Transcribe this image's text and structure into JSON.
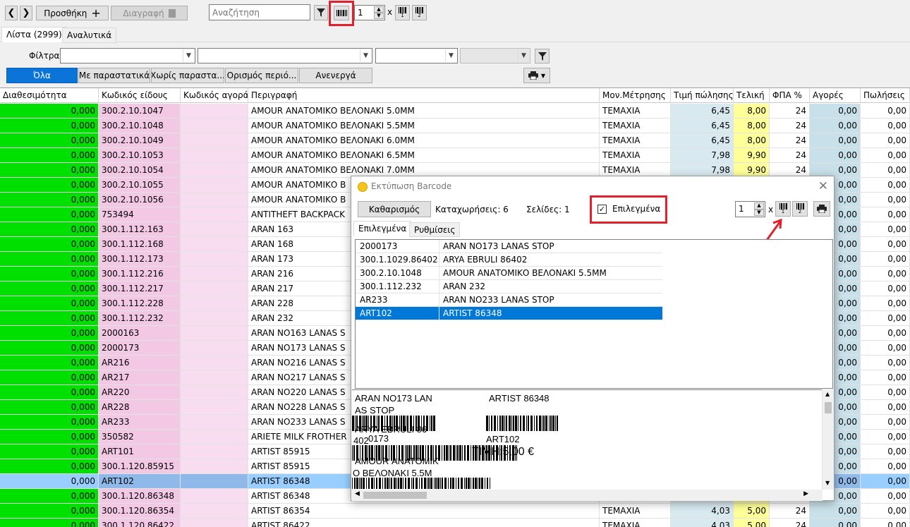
{
  "toolbar": {
    "add_label": "Προσθήκη",
    "delete_label": "Διαγραφή",
    "search_placeholder": "Αναζήτηση",
    "copies_value": "1",
    "times_label": "x",
    "label1": "1",
    "label2": "2"
  },
  "tabs": [
    "Λίστα (2999)",
    "Αναλυτικά"
  ],
  "filters": {
    "label": "Φίλτρα",
    "buttons": [
      "Όλα",
      "Με παραστατικά",
      "Χωρίς παραστα...",
      "Ορισμός περιό...",
      "Ανενεργά"
    ]
  },
  "grid": {
    "headers": [
      "Διαθεσιμότητα",
      "Κωδικός είδους",
      "Κωδικός αγοράς",
      "Περιγραφή",
      "Μον.Μέτρησης",
      "Τιμή πώλησης",
      "Τελική",
      "ΦΠΑ %",
      "Αγορές",
      "Πωλήσεις"
    ],
    "rows": [
      [
        "0,000",
        "300.2.10.1047",
        "",
        "AMOUR ΑΝΑΤΟΜΙΚΟ ΒΕΛΟΝΑΚΙ 5.0MM",
        "ΤΕΜΑΧΙΑ",
        "6,45",
        "8,00",
        "24",
        "0,00",
        "0,00"
      ],
      [
        "0,000",
        "300.2.10.1048",
        "",
        "AMOUR ΑΝΑΤΟΜΙΚΟ ΒΕΛΟΝΑΚΙ 5.5MM",
        "ΤΕΜΑΧΙΑ",
        "6,45",
        "8,00",
        "24",
        "0,00",
        "0,00"
      ],
      [
        "0,000",
        "300.2.10.1049",
        "",
        "AMOUR ΑΝΑΤΟΜΙΚΟ ΒΕΛΟΝΑΚΙ 6.0MM",
        "ΤΕΜΑΧΙΑ",
        "6,45",
        "8,00",
        "24",
        "0,00",
        "0,00"
      ],
      [
        "0,000",
        "300.2.10.1053",
        "",
        "AMOUR ΑΝΑΤΟΜΙΚΟ ΒΕΛΟΝΑΚΙ 6.5MM",
        "ΤΕΜΑΧΙΑ",
        "7,98",
        "9,90",
        "24",
        "0,00",
        "0,00"
      ],
      [
        "0,000",
        "300.2.10.1054",
        "",
        "AMOUR ΑΝΑΤΟΜΙΚΟ ΒΕΛΟΝΑΚΙ 7.0MM",
        "ΤΕΜΑΧΙΑ",
        "7,98",
        "9,90",
        "24",
        "0,00",
        "0,00"
      ],
      [
        "0,000",
        "300.2.10.1055",
        "",
        "AMOUR ΑΝΑΤΟΜΙΚΟ Β",
        "",
        "",
        "",
        "",
        "0,00",
        "0,00"
      ],
      [
        "0,000",
        "300.2.10.1056",
        "",
        "AMOUR ΑΝΑΤΟΜΙΚΟ Β",
        "",
        "",
        "",
        "",
        "0,00",
        "0,00"
      ],
      [
        "0,000",
        "753494",
        "",
        "ANTITHEFT BACKPACK",
        "",
        "",
        "",
        "",
        "0,00",
        "0,00"
      ],
      [
        "0,000",
        "300.1.112.163",
        "",
        "ARAN 163",
        "",
        "",
        "",
        "",
        "0,00",
        "0,00"
      ],
      [
        "0,000",
        "300.1.112.168",
        "",
        "ARAN 168",
        "",
        "",
        "",
        "",
        "0,00",
        "0,00"
      ],
      [
        "0,000",
        "300.1.112.173",
        "",
        "ARAN 173",
        "",
        "",
        "",
        "",
        "0,00",
        "0,00"
      ],
      [
        "0,000",
        "300.1.112.216",
        "",
        "ARAN 216",
        "",
        "",
        "",
        "",
        "0,00",
        "0,00"
      ],
      [
        "0,000",
        "300.1.112.217",
        "",
        "ARAN 217",
        "",
        "",
        "",
        "",
        "0,00",
        "0,00"
      ],
      [
        "0,000",
        "300.1.112.228",
        "",
        "ARAN 228",
        "",
        "",
        "",
        "",
        "0,00",
        "0,00"
      ],
      [
        "0,000",
        "300.1.112.232",
        "",
        "ARAN 232",
        "",
        "",
        "",
        "",
        "0,00",
        "0,00"
      ],
      [
        "0,000",
        "2000163",
        "",
        "ARAN NO163 LANAS S",
        "",
        "",
        "",
        "",
        "0,00",
        "0,00"
      ],
      [
        "0,000",
        "2000173",
        "",
        "ARAN NO173 LANAS S",
        "",
        "",
        "",
        "",
        "0,00",
        "0,00"
      ],
      [
        "0,000",
        "AR216",
        "",
        "ARAN NO216 LANAS S",
        "",
        "",
        "",
        "",
        "0,00",
        "0,00"
      ],
      [
        "0,000",
        "AR217",
        "",
        "ARAN NO217 LANAS S",
        "",
        "",
        "",
        "",
        "0,00",
        "0,00"
      ],
      [
        "0,000",
        "AR220",
        "",
        "ARAN NO220 LANAS S",
        "",
        "",
        "",
        "",
        "0,00",
        "0,00"
      ],
      [
        "0,000",
        "AR228",
        "",
        "ARAN NO228 LANAS S",
        "",
        "",
        "",
        "",
        "0,00",
        "0,00"
      ],
      [
        "0,000",
        "AR233",
        "",
        "ARAN NO233 LANAS S",
        "",
        "",
        "",
        "",
        "0,00",
        "0,00"
      ],
      [
        "0,000",
        "350582",
        "",
        "ARIETE MILK FROTHER",
        "",
        "",
        "",
        "",
        "0,00",
        "0,00"
      ],
      [
        "0,000",
        "ART101",
        "",
        "ARTIST 85915",
        "",
        "",
        "",
        "",
        "0,00",
        "0,00"
      ],
      [
        "0,000",
        "300.1.120.85915",
        "",
        "ARTIST 85915",
        "",
        "",
        "",
        "",
        "0,00",
        "0,00"
      ],
      [
        "0,000",
        "ART102",
        "",
        "ARTIST 86348",
        "",
        "",
        "",
        "",
        "0,00",
        "0,00"
      ],
      [
        "0,000",
        "300.1.120.86348",
        "",
        "ARTIST 86348",
        "",
        "",
        "",
        "",
        "0,00",
        "0,00"
      ],
      [
        "0,000",
        "300.1.120.86354",
        "",
        "ARTIST 86354",
        "ΤΕΜΑΧΙΑ",
        "4,03",
        "5,00",
        "24",
        "0,00",
        "0,00"
      ],
      [
        "0,000",
        "300.1.120.86422",
        "",
        "ARTIST 86422",
        "ΤΕΜΑΧΙΑ",
        "4,03",
        "5,00",
        "24",
        "0,00",
        "0,00"
      ]
    ],
    "selected_row": 25
  },
  "dialog": {
    "title": "Εκτύπωση Barcode",
    "clear_button": "Καθαρισμός",
    "entries_text": "Καταχωρήσεις: 6",
    "pages_text": "Σελίδες: 1",
    "selected_checkbox": "Επιλεγμένα",
    "copies_value": "1",
    "times_label": "x",
    "tabs": [
      "Επιλεγμένα",
      "Ρυθμίσεις"
    ],
    "list": [
      [
        "2000173",
        "ARAN NO173 LANAS STOP"
      ],
      [
        "300.1.1029.86402",
        "ARYA EBRULI 86402"
      ],
      [
        "300.2.10.1048",
        "AMOUR ΑΝΑΤΟΜΙΚΟ ΒΕΛΟΝΑΚΙ 5.5MM"
      ],
      [
        "300.1.112.232",
        "ARAN 232"
      ],
      [
        "AR233",
        "ARAN NO233 LANAS STOP"
      ],
      [
        "ART102",
        "ARTIST 86348"
      ]
    ],
    "list_selected": 5,
    "preview": {
      "l1a": "ARAN NO173 LAN",
      "l1b": "AS STOP",
      "r1": "ARTIST 86348",
      "l2a": "ARYA EBRULI 86",
      "l2b": "402",
      "l2c": "0173",
      "r2": "ART102",
      "l3a": "AMOUR ΑΝΑΤΟΜΙΚ",
      "l3b": "Ο ΒΕΛΟΝΑΚΙ 5.5M",
      "price": "ΤΙΜΗ:5,00 €"
    }
  },
  "colors": {
    "availability": "#00e000",
    "code": "#f2c8e4",
    "buycode": "#f8dcef",
    "price": "#d8eaf0",
    "final": "#ffff99",
    "buy": "#c8e0ea",
    "selected_row": "#99cfff",
    "selected_cells": "#8fb9e8",
    "highlight": "#e0202a"
  }
}
